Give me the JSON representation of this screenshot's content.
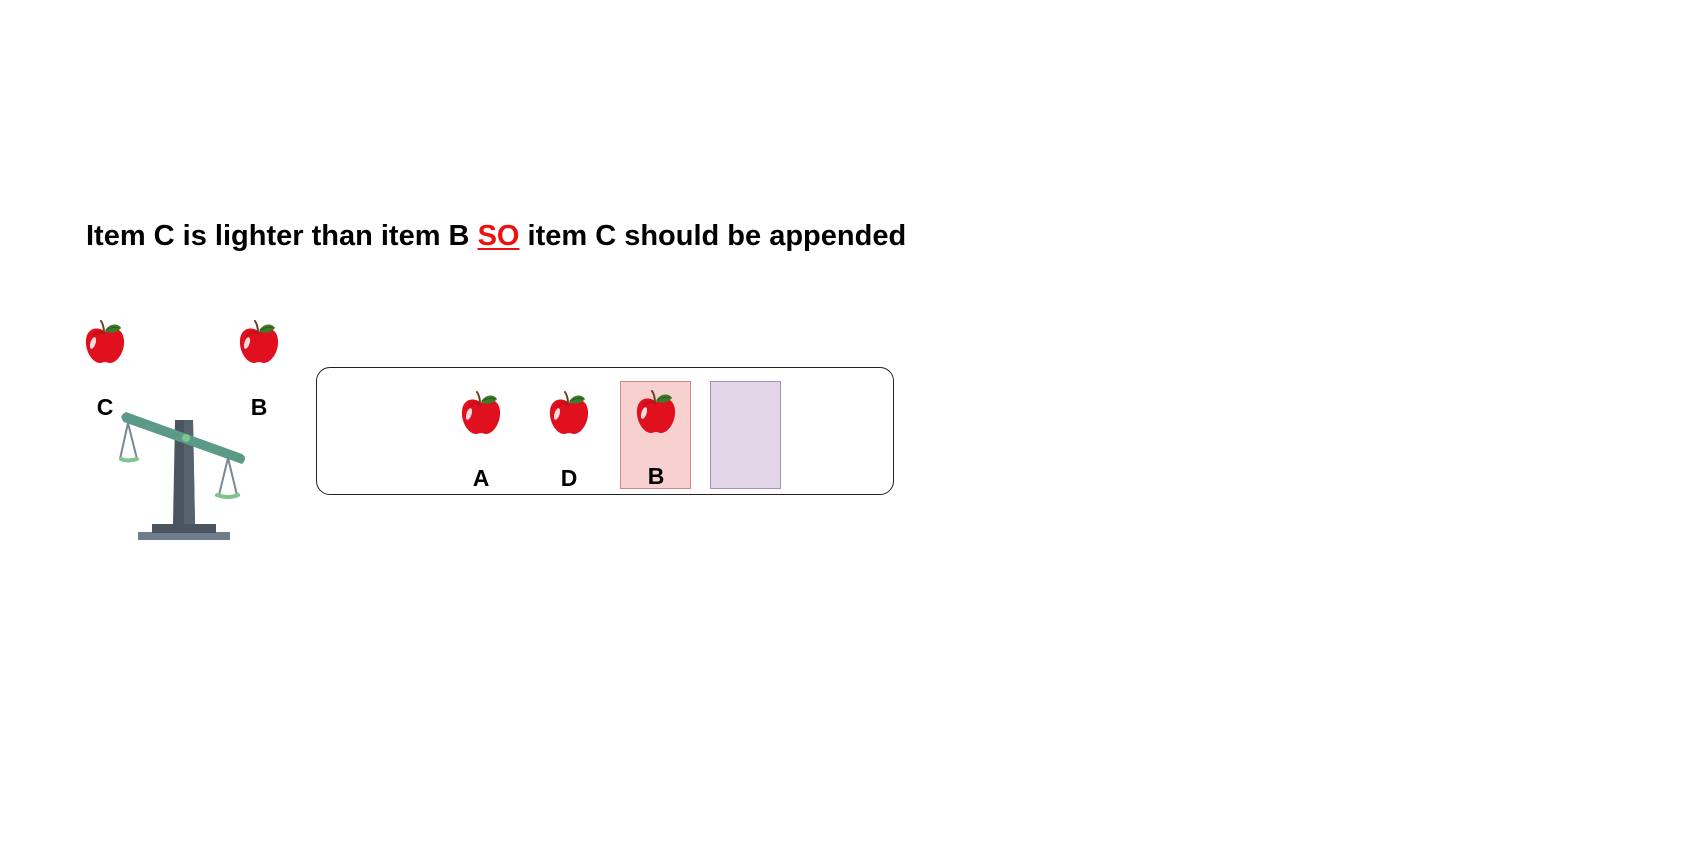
{
  "headline": {
    "part1": "Item C is lighter than item B ",
    "connector": "SO",
    "part2": " item C should be appended"
  },
  "colors": {
    "connector": "#ee1111",
    "highlight_slot_fill": "#f7d0d0",
    "highlight_slot_border": "#d98585",
    "empty_slot_fill": "#e1d5e7",
    "empty_slot_border": "#a692b8",
    "apple": "#e0101e",
    "scale_beam": "#5b9a86",
    "scale_post": "#4a5560",
    "scale_pan": "#7dc48e"
  },
  "icons": {
    "apple": "apple-icon",
    "scale": "balance-scale-icon"
  },
  "comparison": {
    "left_item": "C",
    "right_item": "B",
    "heavier_side": "right"
  },
  "list": {
    "items": [
      {
        "label": "A",
        "state": "normal"
      },
      {
        "label": "D",
        "state": "normal"
      },
      {
        "label": "B",
        "state": "highlighted"
      }
    ],
    "empty_slot": true
  }
}
